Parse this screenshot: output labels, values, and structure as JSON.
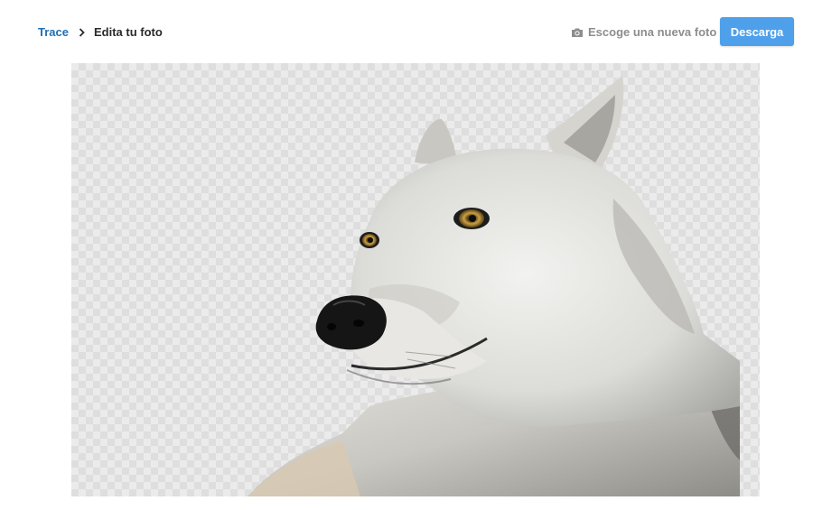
{
  "breadcrumb": {
    "root": "Trace",
    "current": "Edita tu foto"
  },
  "toolbar": {
    "new_photo_label": "Escoge una nueva foto",
    "download_label": "Descarga"
  },
  "canvas": {
    "subject": "wolf photo with background removed",
    "background": "transparent-checkerboard"
  },
  "colors": {
    "link": "#1f6fb2",
    "button": "#4ea0ea",
    "muted": "#8d8d8d"
  },
  "icons": {
    "separator": "chevron-right-icon",
    "new_photo": "camera-icon"
  }
}
